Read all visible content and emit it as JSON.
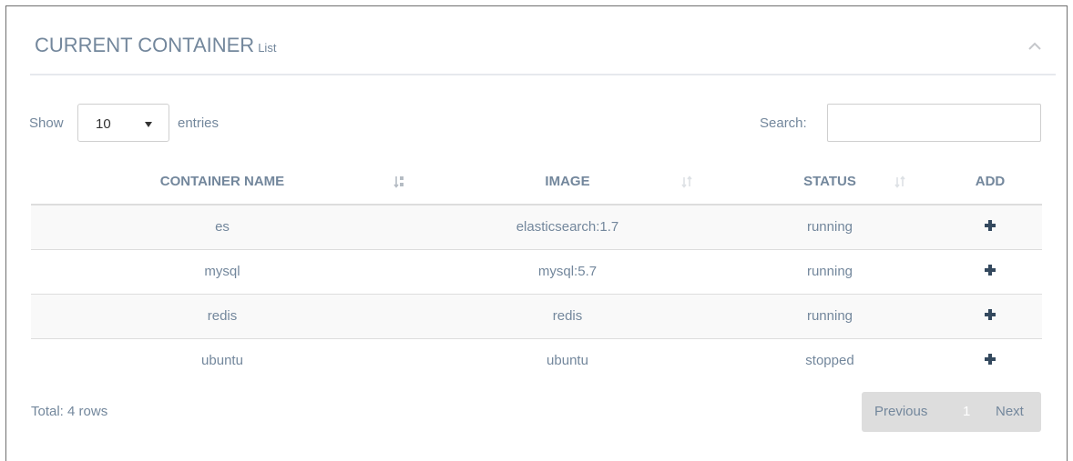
{
  "panel": {
    "title": "CURRENT CONTAINER",
    "subtitle": "List",
    "collapse_icon": "chevron-up-icon"
  },
  "controls": {
    "show_label": "Show",
    "page_length": "10",
    "entries_label": "entries",
    "search_label": "Search:",
    "search_value": ""
  },
  "table": {
    "columns": [
      {
        "label": "CONTAINER NAME",
        "sort_icon": "sort-alpha-asc-icon"
      },
      {
        "label": "IMAGE",
        "sort_icon": "sort-icon"
      },
      {
        "label": "STATUS",
        "sort_icon": "sort-icon"
      },
      {
        "label": "ADD"
      }
    ],
    "rows": [
      {
        "name": "es",
        "image": "elasticsearch:1.7",
        "status": "running",
        "add_icon": "plus-icon"
      },
      {
        "name": "mysql",
        "image": "mysql:5.7",
        "status": "running",
        "add_icon": "plus-icon"
      },
      {
        "name": "redis",
        "image": "redis",
        "status": "running",
        "add_icon": "plus-icon"
      },
      {
        "name": "ubuntu",
        "image": "ubuntu",
        "status": "stopped",
        "add_icon": "plus-icon"
      }
    ]
  },
  "footer": {
    "info": "Total: 4 rows",
    "previous_label": "Previous",
    "current_page": "1",
    "next_label": "Next"
  },
  "colors": {
    "text": "#73879c",
    "plus": "#34495e",
    "pager_bg": "#dddddd",
    "stripe": "#f9f9f9"
  }
}
